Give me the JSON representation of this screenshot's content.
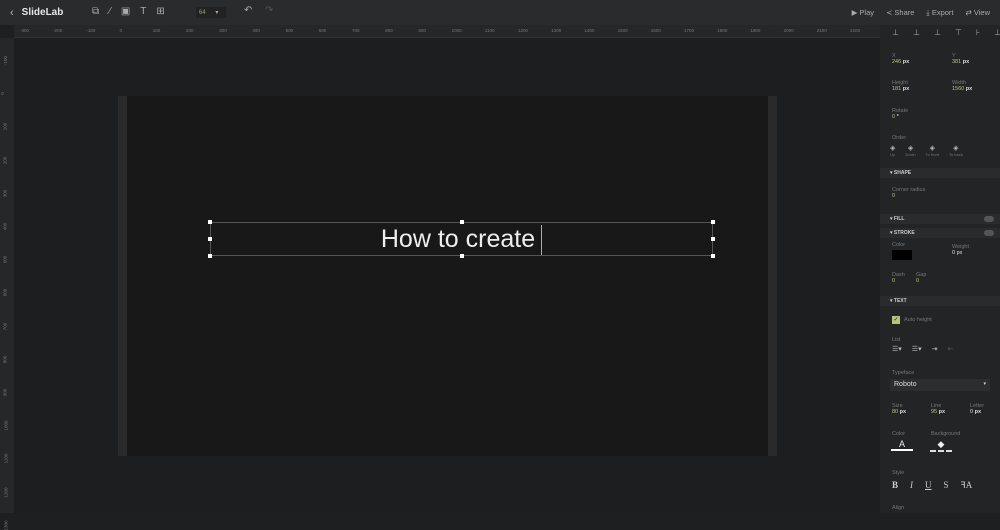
{
  "app": {
    "title": "SlideLab",
    "zoom": "64"
  },
  "toolbar": {
    "tools": [
      "shapes-icon",
      "line-icon",
      "image-icon",
      "text-icon",
      "table-icon"
    ],
    "actions": [
      {
        "icon": "play-icon",
        "label": "Play"
      },
      {
        "icon": "share-icon",
        "label": "Share"
      },
      {
        "icon": "export-icon",
        "label": "Export"
      },
      {
        "icon": "view-icon",
        "label": "View"
      }
    ]
  },
  "ruler": {
    "h": [
      "-300",
      "-200",
      "-100",
      "0",
      "100",
      "200",
      "300",
      "400",
      "500",
      "600",
      "700",
      "800",
      "900",
      "1000",
      "1100",
      "1200",
      "1300",
      "1400",
      "1500",
      "1600",
      "1700",
      "1800",
      "1900",
      "2000",
      "2100",
      "2200"
    ],
    "v": [
      "-100",
      "0",
      "100",
      "200",
      "300",
      "400",
      "500",
      "600",
      "700",
      "800",
      "900",
      "1000",
      "1100",
      "1200",
      "1300"
    ]
  },
  "canvas": {
    "text": "How to create"
  },
  "panel": {
    "x": {
      "label": "X",
      "value": "246",
      "unit": "px"
    },
    "y": {
      "label": "Y",
      "value": "381",
      "unit": "px"
    },
    "height": {
      "label": "Height",
      "value": "181",
      "unit": "px"
    },
    "width": {
      "label": "Width",
      "value": "1560",
      "unit": "px"
    },
    "rotate": {
      "label": "Rotate",
      "value": "0",
      "unit": "°"
    },
    "order": {
      "label": "Order",
      "items": [
        "Up",
        "Down",
        "To front",
        "To back"
      ]
    },
    "shape": {
      "title": "SHAPE",
      "corner_label": "Corner radius",
      "corner": "0"
    },
    "fill": {
      "title": "FILL"
    },
    "stroke": {
      "title": "STROKE",
      "color_label": "Color",
      "color": "#000000",
      "weight_label": "Weight",
      "weight": "0 px",
      "dash_label": "Dash",
      "dash": "0",
      "gap_label": "Gap",
      "gap": "0"
    },
    "text": {
      "title": "TEXT",
      "auto_height": "Auto height",
      "list_label": "List",
      "typeface_label": "Typeface",
      "typeface": "Roboto",
      "size_label": "Size",
      "size": "80",
      "line_label": "Line",
      "line": "95",
      "letter_label": "Letter",
      "letter": "0",
      "unit": "px",
      "color_label": "Color",
      "background_label": "Background",
      "style_label": "Style",
      "styles": [
        "B",
        "I",
        "U",
        "S",
        "ꟻA"
      ],
      "align_label": "Align"
    },
    "accent": "#b9c27a"
  }
}
